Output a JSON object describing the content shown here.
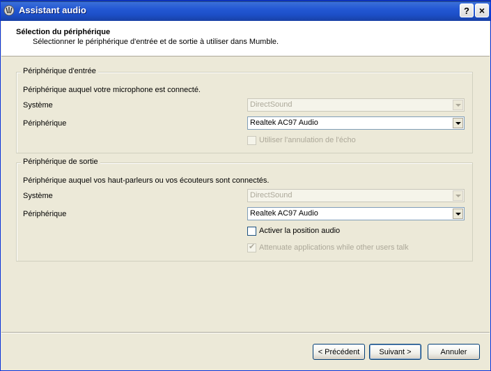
{
  "window": {
    "title": "Assistant audio",
    "help_glyph": "?",
    "close_glyph": "×"
  },
  "header": {
    "title": "Sélection du périphérique",
    "subtitle": "Sélectionner le périphérique d'entrée et de sortie à utiliser dans Mumble."
  },
  "input_group": {
    "legend": "Périphérique d'entrée",
    "description": "Périphérique auquel votre microphone est connecté.",
    "system_label": "Système",
    "system_value": "DirectSound",
    "device_label": "Périphérique",
    "device_value": "Realtek AC97 Audio",
    "echo_cancel_label": "Utiliser l'annulation de l'écho",
    "echo_cancel_checked": false
  },
  "output_group": {
    "legend": "Périphérique de sortie",
    "description": "Périphérique auquel vos haut-parleurs ou vos écouteurs sont connectés.",
    "system_label": "Système",
    "system_value": "DirectSound",
    "device_label": "Périphérique",
    "device_value": "Realtek AC97 Audio",
    "positional_label": "Activer la position audio",
    "positional_checked": false,
    "attenuate_label": "Attenuate applications while other users talk",
    "attenuate_checked": true,
    "check_glyph": "✔"
  },
  "buttons": {
    "back": "< Précédent",
    "next": "Suivant >",
    "cancel": "Annuler"
  }
}
